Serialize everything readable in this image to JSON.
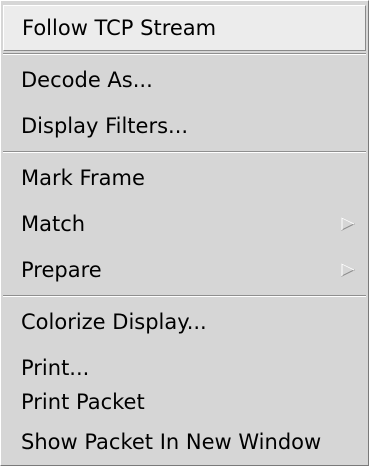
{
  "menu": {
    "items": [
      {
        "label": "Follow TCP Stream"
      },
      {
        "label": "Decode As..."
      },
      {
        "label": "Display Filters..."
      },
      {
        "label": "Mark Frame"
      },
      {
        "label": "Match",
        "submenu": true
      },
      {
        "label": "Prepare",
        "submenu": true
      },
      {
        "label": "Colorize Display..."
      },
      {
        "label": "Print..."
      },
      {
        "label": "Print Packet"
      },
      {
        "label": "Show Packet In New Window"
      }
    ],
    "colors": {
      "background": "#d6d6d6",
      "highlight": "#ececec",
      "text": "#000000"
    }
  }
}
